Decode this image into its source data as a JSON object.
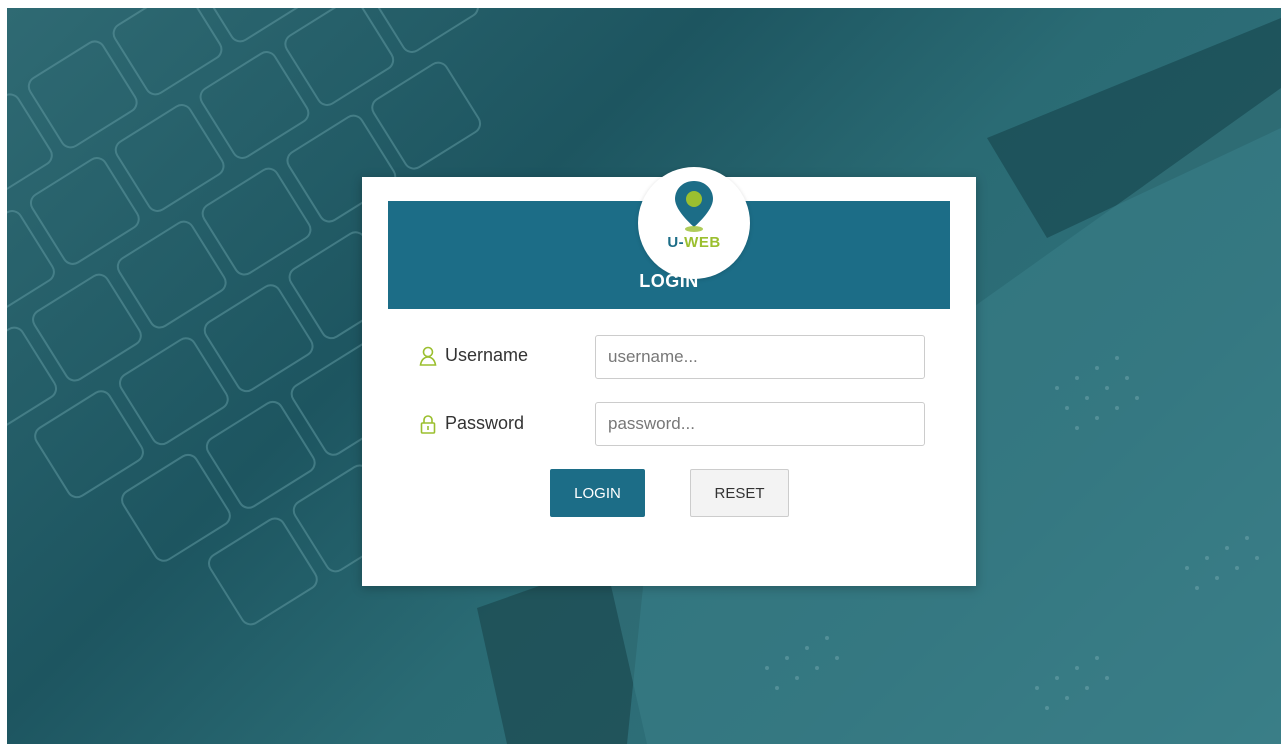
{
  "colors": {
    "header_bg": "#1c6d87",
    "brand_green": "#9bbf2f",
    "reset_bg": "#f3f3f3"
  },
  "logo": {
    "icon": "location-pin-logo-icon",
    "text_prefix": "U-",
    "text_accent": "WEB"
  },
  "header": {
    "title": "LOGIN"
  },
  "form": {
    "username": {
      "icon": "user-icon",
      "label": "Username",
      "placeholder": "username..."
    },
    "password": {
      "icon": "lock-icon",
      "label": "Password",
      "placeholder": "password..."
    }
  },
  "buttons": {
    "login": "LOGIN",
    "reset": "RESET"
  }
}
